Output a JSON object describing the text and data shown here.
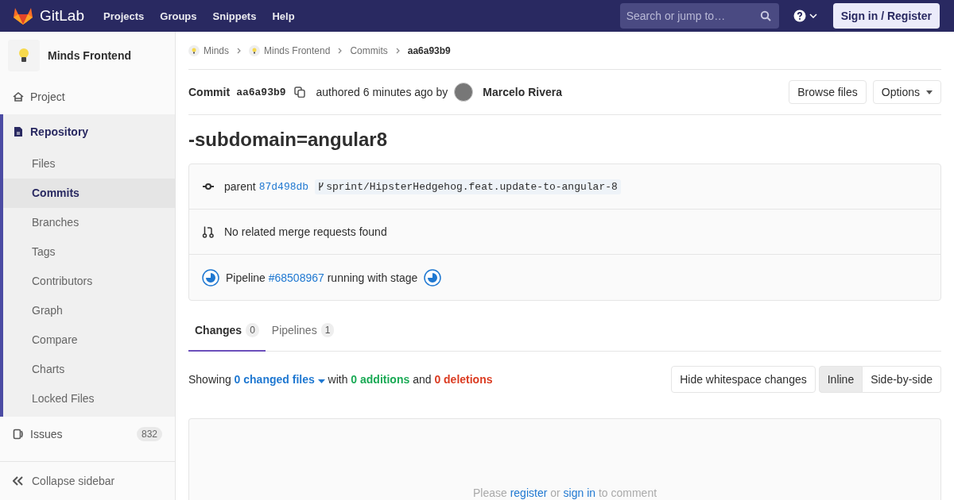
{
  "navbar": {
    "brand": "GitLab",
    "links": [
      "Projects",
      "Groups",
      "Snippets",
      "Help"
    ],
    "search": {
      "placeholder": "Search or jump to…"
    },
    "sign_in": "Sign in / Register"
  },
  "sidebar": {
    "project_name": "Minds Frontend",
    "items": [
      {
        "kind": "link",
        "label": "Project"
      },
      {
        "kind": "section",
        "label": "Repository",
        "expanded": true,
        "children": [
          {
            "label": "Files",
            "selected": false
          },
          {
            "label": "Commits",
            "selected": true
          },
          {
            "label": "Branches",
            "selected": false
          },
          {
            "label": "Tags",
            "selected": false
          },
          {
            "label": "Contributors",
            "selected": false
          },
          {
            "label": "Graph",
            "selected": false
          },
          {
            "label": "Compare",
            "selected": false
          },
          {
            "label": "Charts",
            "selected": false
          },
          {
            "label": "Locked Files",
            "selected": false
          }
        ]
      },
      {
        "kind": "link",
        "label": "Issues",
        "count": "832"
      }
    ],
    "collapse": "Collapse sidebar"
  },
  "breadcrumbs": [
    {
      "label": "Minds",
      "avatar": true
    },
    {
      "label": "Minds Frontend",
      "avatar": true
    },
    {
      "label": "Commits",
      "avatar": false
    },
    {
      "label": "aa6a93b9",
      "avatar": false
    }
  ],
  "commit": {
    "label": "Commit",
    "sha": "aa6a93b9",
    "authored": "authored 6 minutes ago by",
    "author": "Marcelo Rivera",
    "buttons": {
      "browse": "Browse files",
      "options": "Options"
    }
  },
  "title": "-subdomain=angular8",
  "info": {
    "parent_label": "parent",
    "parent_sha": "87d498db",
    "branch": "sprint/HipsterHedgehog.feat.update-to-angular-8",
    "merge_requests": "No related merge requests found",
    "pipeline_label": "Pipeline",
    "pipeline_id": "#68508967",
    "pipeline_status": "running with stage"
  },
  "tabs": [
    {
      "label": "Changes",
      "count": "0",
      "selected": true
    },
    {
      "label": "Pipelines",
      "count": "1",
      "selected": false
    }
  ],
  "summary": {
    "showing": "Showing",
    "changed": "0 changed files",
    "with": "with",
    "additions": "0 additions",
    "and": "and",
    "deletions": "0 deletions"
  },
  "diff_controls": {
    "whitespace": "Hide whitespace changes",
    "views": [
      {
        "label": "Inline",
        "selected": true
      },
      {
        "label": "Side-by-side",
        "selected": false
      }
    ]
  },
  "comment": {
    "please": "Please",
    "register": "register",
    "or": "or",
    "sign_in": "sign in",
    "to_comment": "to comment"
  }
}
